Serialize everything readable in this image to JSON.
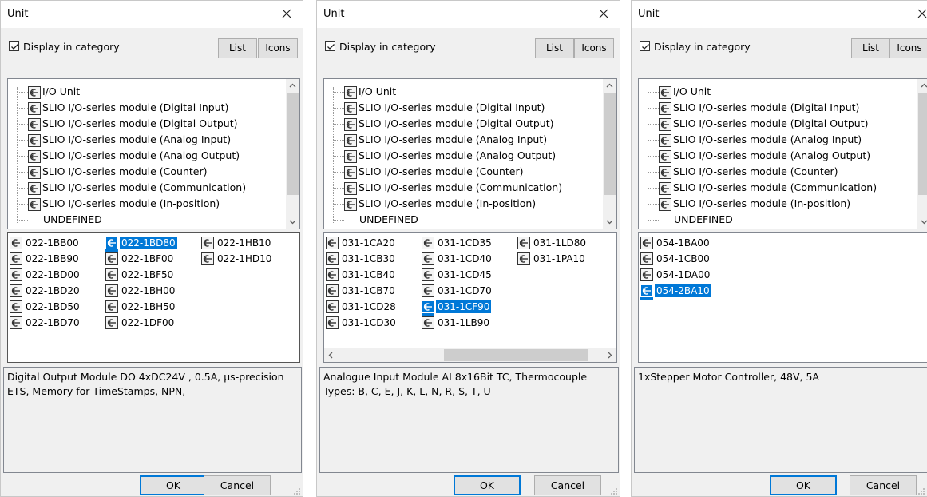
{
  "dialogs": [
    {
      "title": "Unit",
      "display_in_category": "Display in category",
      "list_button": "List",
      "icons_button": "Icons",
      "tree_items": [
        "I/O Unit",
        "SLIO I/O-series module (Digital Input)",
        "SLIO I/O-series module (Digital Output)",
        "SLIO I/O-series module (Analog Input)",
        "SLIO I/O-series module (Analog Output)",
        "SLIO I/O-series module (Counter)",
        "SLIO I/O-series module (Communication)",
        "SLIO I/O-series module (In-position)",
        "UNDEFINED"
      ],
      "modules": [
        [
          "022-1BB00",
          "022-1BB90",
          "022-1BD00",
          "022-1BD20",
          "022-1BD50",
          "022-1BD70"
        ],
        [
          "022-1BD80",
          "022-1BF00",
          "022-1BF50",
          "022-1BH00",
          "022-1BH50",
          "022-1DF00"
        ],
        [
          "022-1HB10",
          "022-1HD10"
        ]
      ],
      "selected_module": "022-1BD80",
      "description": "Digital Output Module DO 4xDC24V , 0.5A, μs-precision ETS, Memory for TimeStamps, NPN,",
      "ok": "OK",
      "cancel": "Cancel"
    },
    {
      "title": "Unit",
      "display_in_category": "Display in category",
      "list_button": "List",
      "icons_button": "Icons",
      "tree_items": [
        "I/O Unit",
        "SLIO I/O-series module (Digital Input)",
        "SLIO I/O-series module (Digital Output)",
        "SLIO I/O-series module (Analog Input)",
        "SLIO I/O-series module (Analog Output)",
        "SLIO I/O-series module (Counter)",
        "SLIO I/O-series module (Communication)",
        "SLIO I/O-series module (In-position)",
        "UNDEFINED"
      ],
      "modules": [
        [
          "031-1CA20",
          "031-1CB30",
          "031-1CB40",
          "031-1CB70",
          "031-1CD28",
          "031-1CD30"
        ],
        [
          "031-1CD35",
          "031-1CD40",
          "031-1CD45",
          "031-1CD70",
          "031-1CF90",
          "031-1LB90"
        ],
        [
          "031-1LD80",
          "031-1PA10"
        ]
      ],
      "selected_module": "031-1CF90",
      "description": "Analogue Input Module AI 8x16Bit TC, Thermocouple Types: B, C, E, J, K, L, N, R, S, T, U",
      "ok": "OK",
      "cancel": "Cancel"
    },
    {
      "title": "Unit",
      "display_in_category": "Display in category",
      "list_button": "List",
      "icons_button": "Icons",
      "tree_items": [
        "I/O Unit",
        "SLIO I/O-series module (Digital Input)",
        "SLIO I/O-series module (Digital Output)",
        "SLIO I/O-series module (Analog Input)",
        "SLIO I/O-series module (Analog Output)",
        "SLIO I/O-series module (Counter)",
        "SLIO I/O-series module (Communication)",
        "SLIO I/O-series module (In-position)",
        "UNDEFINED"
      ],
      "modules": [
        [
          "054-1BA00",
          "054-1CB00",
          "054-1DA00",
          "054-2BA10"
        ]
      ],
      "selected_module": "054-2BA10",
      "description": "1xStepper Motor Controller, 48V, 5A",
      "ok": "OK",
      "cancel": "Cancel"
    }
  ],
  "icons": {
    "module": "module-connector-icon",
    "close": "close-icon",
    "check": "check-icon"
  },
  "colors": {
    "selection": "#0078d7",
    "dialog_bg": "#f0f0f0"
  }
}
